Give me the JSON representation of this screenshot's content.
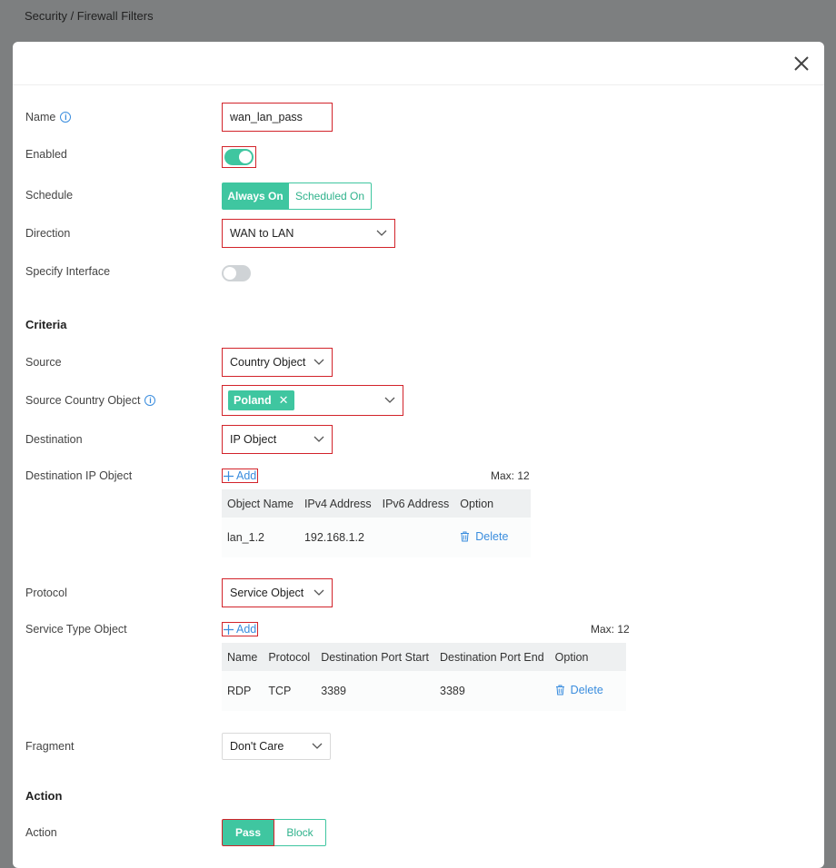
{
  "breadcrumb": "Security / Firewall Filters",
  "form": {
    "name": {
      "label": "Name",
      "value": "wan_lan_pass"
    },
    "enabled": {
      "label": "Enabled",
      "on": true
    },
    "schedule": {
      "label": "Schedule",
      "options": [
        "Always On",
        "Scheduled On"
      ],
      "selected": "Always On"
    },
    "direction": {
      "label": "Direction",
      "value": "WAN to LAN"
    },
    "specify_interface": {
      "label": "Specify Interface",
      "on": false
    }
  },
  "criteria": {
    "title": "Criteria",
    "source": {
      "label": "Source",
      "value": "Country Object"
    },
    "source_country": {
      "label": "Source Country Object",
      "tags": [
        "Poland"
      ]
    },
    "destination": {
      "label": "Destination",
      "value": "IP Object"
    },
    "destination_ip": {
      "label": "Destination IP Object",
      "add_label": "Add",
      "max_label": "Max: 12",
      "columns": [
        "Object Name",
        "IPv4 Address",
        "IPv6 Address",
        "Option"
      ],
      "rows": [
        {
          "name": "lan_1.2",
          "ipv4": "192.168.1.2",
          "ipv6": "",
          "option": "Delete"
        }
      ]
    },
    "protocol": {
      "label": "Protocol",
      "value": "Service Object"
    },
    "service_type": {
      "label": "Service Type Object",
      "add_label": "Add",
      "max_label": "Max: 12",
      "columns": [
        "Name",
        "Protocol",
        "Destination Port Start",
        "Destination Port End",
        "Option"
      ],
      "rows": [
        {
          "name": "RDP",
          "protocol": "TCP",
          "port_start": "3389",
          "port_end": "3389",
          "option": "Delete"
        }
      ]
    },
    "fragment": {
      "label": "Fragment",
      "value": "Don't Care"
    }
  },
  "action": {
    "title": "Action",
    "label": "Action",
    "options": [
      "Pass",
      "Block"
    ],
    "selected": "Pass"
  },
  "colors": {
    "accent": "#3fc6a0",
    "link": "#3a8dde",
    "highlight_border": "#d2232a",
    "overlay": "#7d7f80"
  }
}
